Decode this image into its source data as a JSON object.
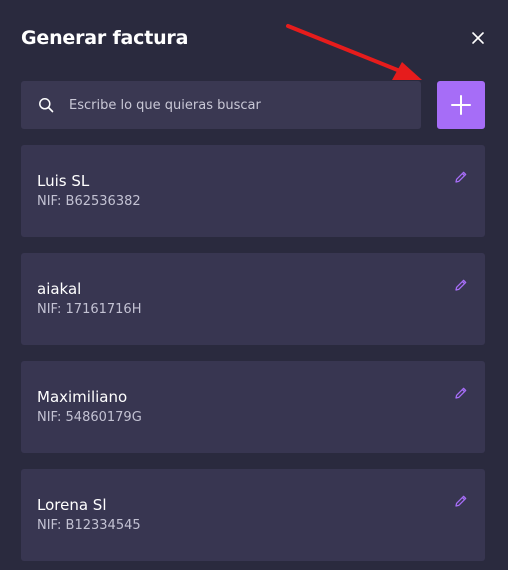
{
  "dialog": {
    "title": "Generar factura",
    "close_icon": "close-icon"
  },
  "search": {
    "placeholder": "Escribe lo que quieras buscar",
    "value": "",
    "icon": "search-icon"
  },
  "add_button": {
    "icon": "plus-icon",
    "color": "#a66df7"
  },
  "annotation": {
    "arrow_color": "#e61c1c"
  },
  "clients": [
    {
      "name": "Luis SL",
      "nif": "NIF: B62536382"
    },
    {
      "name": "aiakal",
      "nif": "NIF: 17161716H"
    },
    {
      "name": "Maximiliano",
      "nif": "NIF: 54860179G"
    },
    {
      "name": "Lorena Sl",
      "nif": "NIF: B12334545"
    }
  ],
  "colors": {
    "background": "#2a2a3e",
    "card": "#383651",
    "accent": "#a66df7"
  }
}
